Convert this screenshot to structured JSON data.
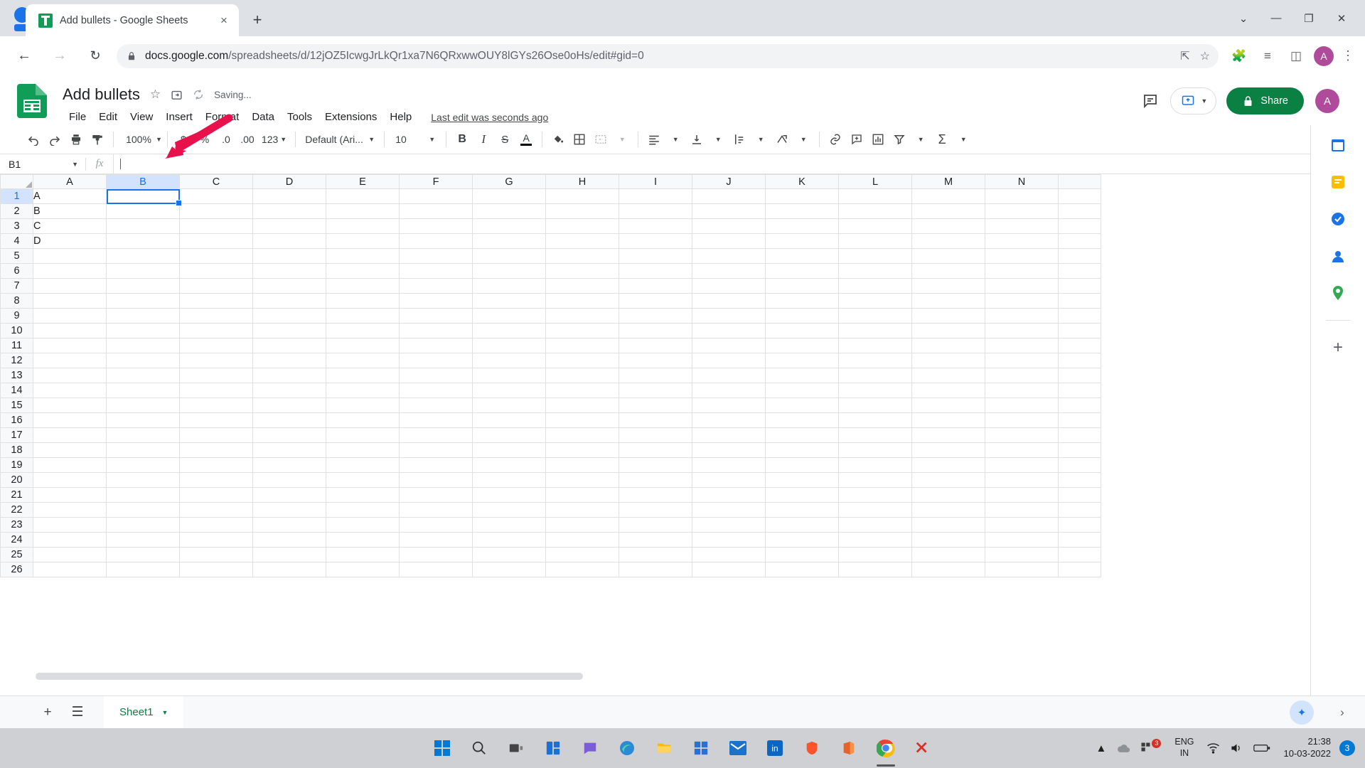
{
  "browser": {
    "tab": {
      "title": "Add bullets - Google Sheets",
      "close_label": "×",
      "favicon_name": "sheets-favicon"
    },
    "new_tab_label": "+",
    "window_controls": {
      "minimize": "—",
      "restore": "❐",
      "close": "✕",
      "chevron": "⌄"
    },
    "nav": {
      "back": "←",
      "forward": "→",
      "reload": "↻"
    },
    "url_full": "docs.google.com/spreadsheets/d/12jOZ5IcwgJrLkQr1xa7N6QRxwwOUY8lGYs26Ose0oHs/edit#gid=0",
    "url_domain": "docs.google.com",
    "url_path": "/spreadsheets/d/12jOZ5IcwgJrLkQr1xa7N6QRxwwOUY8lGYs26Ose0oHs/edit#gid=0",
    "profile_initial": "A"
  },
  "header": {
    "doc_title": "Add bullets",
    "saving_status": "Saving...",
    "last_edit": "Last edit was seconds ago",
    "share_label": "Share",
    "avatar_initial": "A",
    "menus": [
      {
        "label": "File"
      },
      {
        "label": "Edit"
      },
      {
        "label": "View"
      },
      {
        "label": "Insert"
      },
      {
        "label": "Format"
      },
      {
        "label": "Data"
      },
      {
        "label": "Tools"
      },
      {
        "label": "Extensions"
      },
      {
        "label": "Help"
      }
    ]
  },
  "toolbar": {
    "zoom": "100%",
    "font_name": "Default (Ari...",
    "font_size": "10",
    "currency_label": "$",
    "percent_label": "%",
    "decimal_dec_label": ".0",
    "decimal_inc_label": ".00",
    "format_label": "123",
    "bold_label": "B",
    "italic_label": "I",
    "strike_label": "S",
    "textcolor_label": "A",
    "sum_label": "Σ"
  },
  "formula_bar": {
    "name_box": "B1",
    "fx_label": "fx",
    "formula_value": ""
  },
  "grid": {
    "columns": [
      "A",
      "B",
      "C",
      "D",
      "E",
      "F",
      "G",
      "H",
      "I",
      "J",
      "K",
      "L",
      "M",
      "N"
    ],
    "selected_column": "B",
    "selected_row": 1,
    "selected_cell": "B1",
    "rows": [
      {
        "num": "1",
        "cells": [
          "A",
          "",
          "",
          "",
          "",
          "",
          "",
          "",
          "",
          "",
          "",
          "",
          "",
          ""
        ]
      },
      {
        "num": "2",
        "cells": [
          "B",
          "",
          "",
          "",
          "",
          "",
          "",
          "",
          "",
          "",
          "",
          "",
          "",
          ""
        ]
      },
      {
        "num": "3",
        "cells": [
          "C",
          "",
          "",
          "",
          "",
          "",
          "",
          "",
          "",
          "",
          "",
          "",
          "",
          ""
        ]
      },
      {
        "num": "4",
        "cells": [
          "D",
          "",
          "",
          "",
          "",
          "",
          "",
          "",
          "",
          "",
          "",
          "",
          "",
          ""
        ]
      },
      {
        "num": "5",
        "cells": [
          "",
          "",
          "",
          "",
          "",
          "",
          "",
          "",
          "",
          "",
          "",
          "",
          "",
          ""
        ]
      },
      {
        "num": "6",
        "cells": [
          "",
          "",
          "",
          "",
          "",
          "",
          "",
          "",
          "",
          "",
          "",
          "",
          "",
          ""
        ]
      },
      {
        "num": "7",
        "cells": [
          "",
          "",
          "",
          "",
          "",
          "",
          "",
          "",
          "",
          "",
          "",
          "",
          "",
          ""
        ]
      },
      {
        "num": "8",
        "cells": [
          "",
          "",
          "",
          "",
          "",
          "",
          "",
          "",
          "",
          "",
          "",
          "",
          "",
          ""
        ]
      },
      {
        "num": "9",
        "cells": [
          "",
          "",
          "",
          "",
          "",
          "",
          "",
          "",
          "",
          "",
          "",
          "",
          "",
          ""
        ]
      },
      {
        "num": "10",
        "cells": [
          "",
          "",
          "",
          "",
          "",
          "",
          "",
          "",
          "",
          "",
          "",
          "",
          "",
          ""
        ]
      },
      {
        "num": "11",
        "cells": [
          "",
          "",
          "",
          "",
          "",
          "",
          "",
          "",
          "",
          "",
          "",
          "",
          "",
          ""
        ]
      },
      {
        "num": "12",
        "cells": [
          "",
          "",
          "",
          "",
          "",
          "",
          "",
          "",
          "",
          "",
          "",
          "",
          "",
          ""
        ]
      },
      {
        "num": "13",
        "cells": [
          "",
          "",
          "",
          "",
          "",
          "",
          "",
          "",
          "",
          "",
          "",
          "",
          "",
          ""
        ]
      },
      {
        "num": "14",
        "cells": [
          "",
          "",
          "",
          "",
          "",
          "",
          "",
          "",
          "",
          "",
          "",
          "",
          "",
          ""
        ]
      },
      {
        "num": "15",
        "cells": [
          "",
          "",
          "",
          "",
          "",
          "",
          "",
          "",
          "",
          "",
          "",
          "",
          "",
          ""
        ]
      },
      {
        "num": "16",
        "cells": [
          "",
          "",
          "",
          "",
          "",
          "",
          "",
          "",
          "",
          "",
          "",
          "",
          "",
          ""
        ]
      },
      {
        "num": "17",
        "cells": [
          "",
          "",
          "",
          "",
          "",
          "",
          "",
          "",
          "",
          "",
          "",
          "",
          "",
          ""
        ]
      },
      {
        "num": "18",
        "cells": [
          "",
          "",
          "",
          "",
          "",
          "",
          "",
          "",
          "",
          "",
          "",
          "",
          "",
          ""
        ]
      },
      {
        "num": "19",
        "cells": [
          "",
          "",
          "",
          "",
          "",
          "",
          "",
          "",
          "",
          "",
          "",
          "",
          "",
          ""
        ]
      },
      {
        "num": "20",
        "cells": [
          "",
          "",
          "",
          "",
          "",
          "",
          "",
          "",
          "",
          "",
          "",
          "",
          "",
          ""
        ]
      },
      {
        "num": "21",
        "cells": [
          "",
          "",
          "",
          "",
          "",
          "",
          "",
          "",
          "",
          "",
          "",
          "",
          "",
          ""
        ]
      },
      {
        "num": "22",
        "cells": [
          "",
          "",
          "",
          "",
          "",
          "",
          "",
          "",
          "",
          "",
          "",
          "",
          "",
          ""
        ]
      },
      {
        "num": "23",
        "cells": [
          "",
          "",
          "",
          "",
          "",
          "",
          "",
          "",
          "",
          "",
          "",
          "",
          "",
          ""
        ]
      },
      {
        "num": "24",
        "cells": [
          "",
          "",
          "",
          "",
          "",
          "",
          "",
          "",
          "",
          "",
          "",
          "",
          "",
          ""
        ]
      },
      {
        "num": "25",
        "cells": [
          "",
          "",
          "",
          "",
          "",
          "",
          "",
          "",
          "",
          "",
          "",
          "",
          "",
          ""
        ]
      },
      {
        "num": "26",
        "cells": [
          "",
          "",
          "",
          "",
          "",
          "",
          "",
          "",
          "",
          "",
          "",
          "",
          "",
          ""
        ]
      }
    ]
  },
  "sheet_bar": {
    "add_label": "+",
    "all_sheets_label": "☰",
    "tabs": [
      {
        "label": "Sheet1"
      }
    ]
  },
  "annotation": {
    "arrow_color": "#e8114b",
    "arrow_target": "column-b-header"
  },
  "taskbar": {
    "language": "ENG",
    "region": "IN",
    "time": "21:38",
    "date": "10-03-2022",
    "notification_count": "3",
    "badge_count": "3"
  },
  "colors": {
    "accent_blue": "#1a73e8",
    "sheets_green": "#0b8043",
    "selection_header": "#d3e3fd",
    "arrow_red": "#e8114b"
  }
}
